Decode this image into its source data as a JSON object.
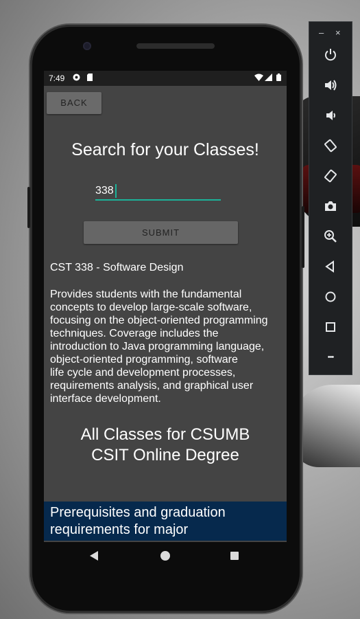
{
  "status_bar": {
    "time": "7:49"
  },
  "app": {
    "back_label": "BACK",
    "title": "Search for your Classes!",
    "search": {
      "value": "338"
    },
    "submit_label": "SUBMIT",
    "course_title": "CST 338 - Software Design",
    "course_description_lines": [
      "Provides students with the fundamental",
      "concepts to develop large-scale software,",
      "focusing on the object-oriented programming",
      "techniques. Coverage includes the",
      "introduction to Java programming language,",
      "object-oriented programming, software",
      "life cycle and development processes,",
      "requirements analysis, and graphical user",
      "interface development."
    ],
    "all_classes_lines": [
      "All Classes for CSUMB",
      "CSIT Online Degree"
    ],
    "prereq_lines": [
      "Prerequisites and graduation",
      "requirements for major"
    ]
  },
  "emulator_panel": {
    "minimize_glyph": "–",
    "close_glyph": "×",
    "more_glyph": "•••",
    "buttons": [
      "power-icon",
      "volume-up-icon",
      "volume-down-icon",
      "rotate-left-icon",
      "rotate-right-icon",
      "camera-icon",
      "zoom-icon",
      "back-icon",
      "home-icon",
      "overview-icon",
      "more-icon"
    ]
  },
  "colors": {
    "screen_bg": "#444444",
    "accent": "#1bb39a",
    "banner": "#06294d"
  }
}
